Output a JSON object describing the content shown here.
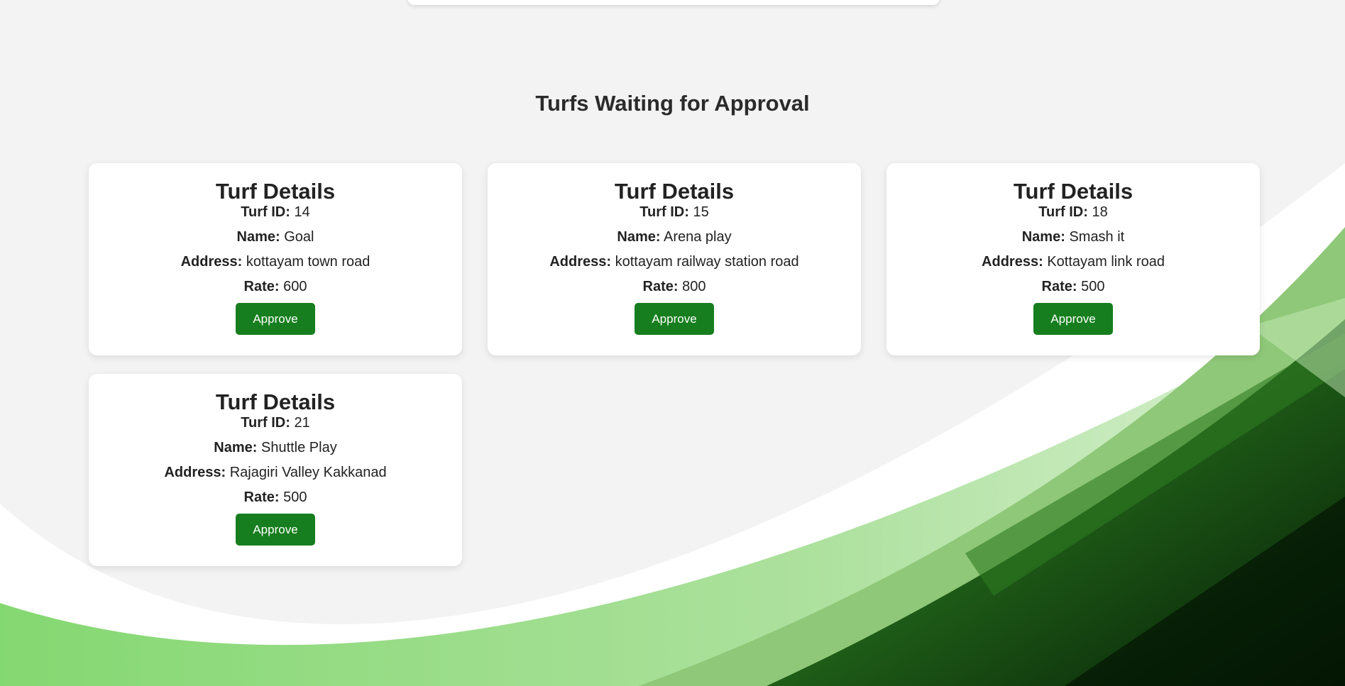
{
  "section_title": "Turfs Waiting for Approval",
  "labels": {
    "card_title": "Turf Details",
    "turf_id": "Turf ID:",
    "name": "Name:",
    "address": "Address:",
    "rate": "Rate:",
    "approve": "Approve"
  },
  "turfs": [
    {
      "id": "14",
      "name": "Goal",
      "address": "kottayam town road",
      "rate": "600"
    },
    {
      "id": "15",
      "name": "Arena play",
      "address": "kottayam railway station road",
      "rate": "800"
    },
    {
      "id": "18",
      "name": "Smash it",
      "address": "Kottayam link road",
      "rate": "500"
    },
    {
      "id": "21",
      "name": "Shuttle Play",
      "address": "Rajagiri Valley Kakkanad",
      "rate": "500"
    }
  ],
  "colors": {
    "background": "#f3f3f3",
    "approve_button": "#167e1e",
    "wave_dark": "#0d3a0b",
    "wave_mid": "#3d8a2a",
    "wave_light": "#8fc878"
  }
}
